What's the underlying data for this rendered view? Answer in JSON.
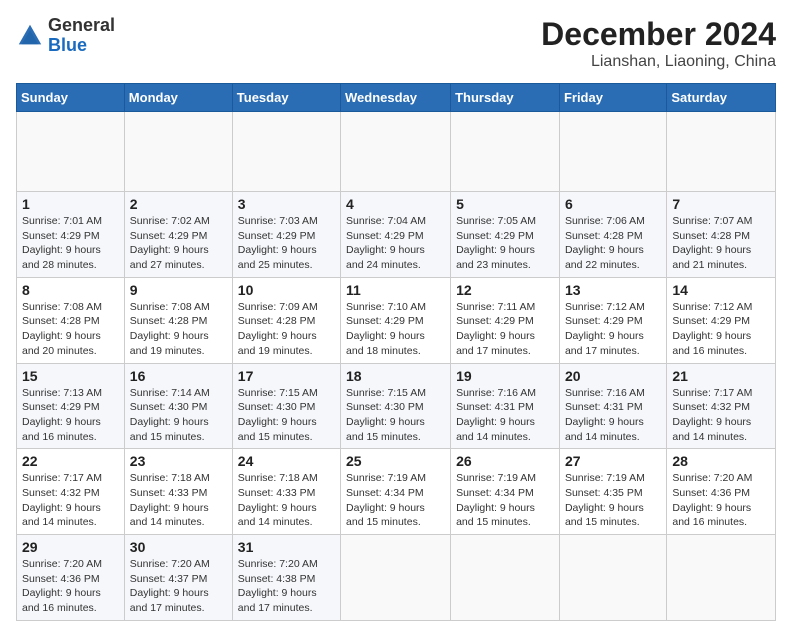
{
  "header": {
    "logo": {
      "general": "General",
      "blue": "Blue"
    },
    "title": "December 2024",
    "location": "Lianshan, Liaoning, China"
  },
  "calendar": {
    "days_of_week": [
      "Sunday",
      "Monday",
      "Tuesday",
      "Wednesday",
      "Thursday",
      "Friday",
      "Saturday"
    ],
    "weeks": [
      [
        {
          "day": "",
          "info": ""
        },
        {
          "day": "",
          "info": ""
        },
        {
          "day": "",
          "info": ""
        },
        {
          "day": "",
          "info": ""
        },
        {
          "day": "",
          "info": ""
        },
        {
          "day": "",
          "info": ""
        },
        {
          "day": "",
          "info": ""
        }
      ],
      [
        {
          "day": "1",
          "sunrise": "7:01 AM",
          "sunset": "4:29 PM",
          "daylight": "9 hours and 28 minutes."
        },
        {
          "day": "2",
          "sunrise": "7:02 AM",
          "sunset": "4:29 PM",
          "daylight": "9 hours and 27 minutes."
        },
        {
          "day": "3",
          "sunrise": "7:03 AM",
          "sunset": "4:29 PM",
          "daylight": "9 hours and 25 minutes."
        },
        {
          "day": "4",
          "sunrise": "7:04 AM",
          "sunset": "4:29 PM",
          "daylight": "9 hours and 24 minutes."
        },
        {
          "day": "5",
          "sunrise": "7:05 AM",
          "sunset": "4:29 PM",
          "daylight": "9 hours and 23 minutes."
        },
        {
          "day": "6",
          "sunrise": "7:06 AM",
          "sunset": "4:28 PM",
          "daylight": "9 hours and 22 minutes."
        },
        {
          "day": "7",
          "sunrise": "7:07 AM",
          "sunset": "4:28 PM",
          "daylight": "9 hours and 21 minutes."
        }
      ],
      [
        {
          "day": "8",
          "sunrise": "7:08 AM",
          "sunset": "4:28 PM",
          "daylight": "9 hours and 20 minutes."
        },
        {
          "day": "9",
          "sunrise": "7:08 AM",
          "sunset": "4:28 PM",
          "daylight": "9 hours and 19 minutes."
        },
        {
          "day": "10",
          "sunrise": "7:09 AM",
          "sunset": "4:28 PM",
          "daylight": "9 hours and 19 minutes."
        },
        {
          "day": "11",
          "sunrise": "7:10 AM",
          "sunset": "4:29 PM",
          "daylight": "9 hours and 18 minutes."
        },
        {
          "day": "12",
          "sunrise": "7:11 AM",
          "sunset": "4:29 PM",
          "daylight": "9 hours and 17 minutes."
        },
        {
          "day": "13",
          "sunrise": "7:12 AM",
          "sunset": "4:29 PM",
          "daylight": "9 hours and 17 minutes."
        },
        {
          "day": "14",
          "sunrise": "7:12 AM",
          "sunset": "4:29 PM",
          "daylight": "9 hours and 16 minutes."
        }
      ],
      [
        {
          "day": "15",
          "sunrise": "7:13 AM",
          "sunset": "4:29 PM",
          "daylight": "9 hours and 16 minutes."
        },
        {
          "day": "16",
          "sunrise": "7:14 AM",
          "sunset": "4:30 PM",
          "daylight": "9 hours and 15 minutes."
        },
        {
          "day": "17",
          "sunrise": "7:15 AM",
          "sunset": "4:30 PM",
          "daylight": "9 hours and 15 minutes."
        },
        {
          "day": "18",
          "sunrise": "7:15 AM",
          "sunset": "4:30 PM",
          "daylight": "9 hours and 15 minutes."
        },
        {
          "day": "19",
          "sunrise": "7:16 AM",
          "sunset": "4:31 PM",
          "daylight": "9 hours and 14 minutes."
        },
        {
          "day": "20",
          "sunrise": "7:16 AM",
          "sunset": "4:31 PM",
          "daylight": "9 hours and 14 minutes."
        },
        {
          "day": "21",
          "sunrise": "7:17 AM",
          "sunset": "4:32 PM",
          "daylight": "9 hours and 14 minutes."
        }
      ],
      [
        {
          "day": "22",
          "sunrise": "7:17 AM",
          "sunset": "4:32 PM",
          "daylight": "9 hours and 14 minutes."
        },
        {
          "day": "23",
          "sunrise": "7:18 AM",
          "sunset": "4:33 PM",
          "daylight": "9 hours and 14 minutes."
        },
        {
          "day": "24",
          "sunrise": "7:18 AM",
          "sunset": "4:33 PM",
          "daylight": "9 hours and 14 minutes."
        },
        {
          "day": "25",
          "sunrise": "7:19 AM",
          "sunset": "4:34 PM",
          "daylight": "9 hours and 15 minutes."
        },
        {
          "day": "26",
          "sunrise": "7:19 AM",
          "sunset": "4:34 PM",
          "daylight": "9 hours and 15 minutes."
        },
        {
          "day": "27",
          "sunrise": "7:19 AM",
          "sunset": "4:35 PM",
          "daylight": "9 hours and 15 minutes."
        },
        {
          "day": "28",
          "sunrise": "7:20 AM",
          "sunset": "4:36 PM",
          "daylight": "9 hours and 16 minutes."
        }
      ],
      [
        {
          "day": "29",
          "sunrise": "7:20 AM",
          "sunset": "4:36 PM",
          "daylight": "9 hours and 16 minutes."
        },
        {
          "day": "30",
          "sunrise": "7:20 AM",
          "sunset": "4:37 PM",
          "daylight": "9 hours and 17 minutes."
        },
        {
          "day": "31",
          "sunrise": "7:20 AM",
          "sunset": "4:38 PM",
          "daylight": "9 hours and 17 minutes."
        },
        {
          "day": "",
          "info": ""
        },
        {
          "day": "",
          "info": ""
        },
        {
          "day": "",
          "info": ""
        },
        {
          "day": "",
          "info": ""
        }
      ]
    ]
  }
}
